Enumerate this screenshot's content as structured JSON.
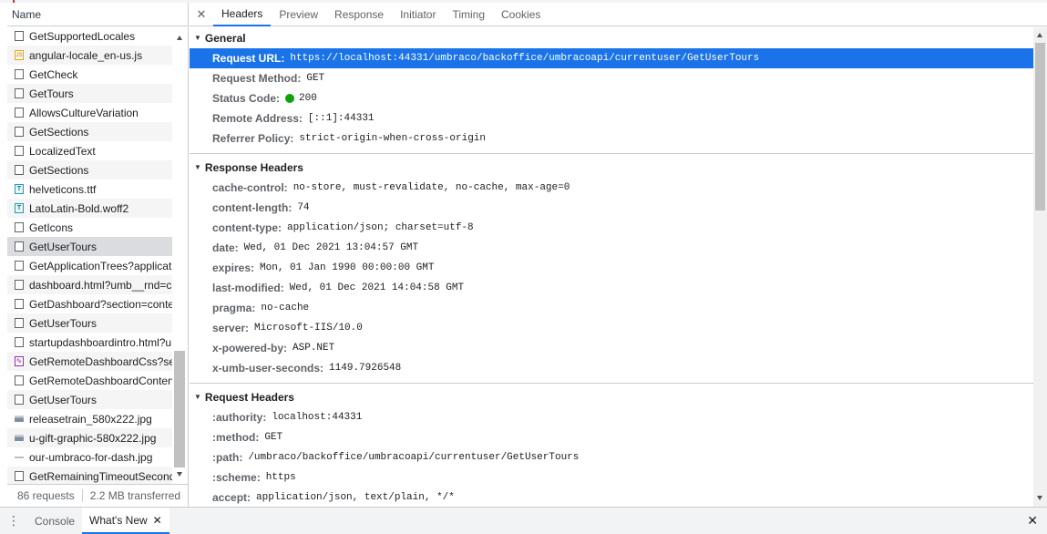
{
  "left_panel": {
    "header": "Name",
    "requests": [
      {
        "name": "GetSupportedLocales",
        "icon": "document-icon"
      },
      {
        "name": "angular-locale_en-us.js",
        "icon": "script-icon"
      },
      {
        "name": "GetCheck",
        "icon": "document-icon"
      },
      {
        "name": "GetTours",
        "icon": "document-icon"
      },
      {
        "name": "AllowsCultureVariation",
        "icon": "document-icon"
      },
      {
        "name": "GetSections",
        "icon": "document-icon"
      },
      {
        "name": "LocalizedText",
        "icon": "document-icon"
      },
      {
        "name": "GetSections",
        "icon": "document-icon"
      },
      {
        "name": "helveticons.ttf",
        "icon": "font-icon"
      },
      {
        "name": "LatoLatin-Bold.woff2",
        "icon": "font-icon"
      },
      {
        "name": "GetIcons",
        "icon": "document-icon"
      },
      {
        "name": "GetUserTours",
        "icon": "document-icon",
        "selected": true
      },
      {
        "name": "GetApplicationTrees?application=...",
        "icon": "document-icon"
      },
      {
        "name": "dashboard.html?umb__rnd=c...",
        "icon": "document-icon"
      },
      {
        "name": "GetDashboard?section=conte...",
        "icon": "document-icon"
      },
      {
        "name": "GetUserTours",
        "icon": "document-icon"
      },
      {
        "name": "startupdashboardintro.html?u...",
        "icon": "document-icon"
      },
      {
        "name": "GetRemoteDashboardCss?sec...",
        "icon": "stylesheet-icon"
      },
      {
        "name": "GetRemoteDashboardContent...",
        "icon": "document-icon"
      },
      {
        "name": "GetUserTours",
        "icon": "document-icon"
      },
      {
        "name": "releasetrain_580x222.jpg",
        "icon": "image-icon"
      },
      {
        "name": "u-gift-graphic-580x222.jpg",
        "icon": "image-icon"
      },
      {
        "name": "our-umbraco-for-dash.jpg",
        "icon": "placeholder-icon"
      },
      {
        "name": "GetRemainingTimeoutSeconds",
        "icon": "document-icon"
      }
    ],
    "status": {
      "requests": "86 requests",
      "transferred": "2.2 MB transferred"
    }
  },
  "detail_tabs": [
    "Headers",
    "Preview",
    "Response",
    "Initiator",
    "Timing",
    "Cookies"
  ],
  "active_tab": "Headers",
  "general": {
    "title": "General",
    "rows": [
      {
        "key": "Request URL:",
        "value": "https://localhost:44331/umbraco/backoffice/umbracoapi/currentuser/GetUserTours"
      },
      {
        "key": "Request Method:",
        "value": "GET"
      },
      {
        "key": "Status Code:",
        "value": "200"
      },
      {
        "key": "Remote Address:",
        "value": "[::1]:44331"
      },
      {
        "key": "Referrer Policy:",
        "value": "strict-origin-when-cross-origin"
      }
    ]
  },
  "response_headers": {
    "title": "Response Headers",
    "rows": [
      {
        "key": "cache-control:",
        "value": "no-store, must-revalidate, no-cache, max-age=0"
      },
      {
        "key": "content-length:",
        "value": "74"
      },
      {
        "key": "content-type:",
        "value": "application/json; charset=utf-8"
      },
      {
        "key": "date:",
        "value": "Wed, 01 Dec 2021 13:04:57 GMT"
      },
      {
        "key": "expires:",
        "value": "Mon, 01 Jan 1990 00:00:00 GMT"
      },
      {
        "key": "last-modified:",
        "value": "Wed, 01 Dec 2021 14:04:58 GMT"
      },
      {
        "key": "pragma:",
        "value": "no-cache"
      },
      {
        "key": "server:",
        "value": "Microsoft-IIS/10.0"
      },
      {
        "key": "x-powered-by:",
        "value": "ASP.NET"
      },
      {
        "key": "x-umb-user-seconds:",
        "value": "1149.7926548"
      }
    ]
  },
  "request_headers": {
    "title": "Request Headers",
    "rows": [
      {
        "key": ":authority:",
        "value": "localhost:44331"
      },
      {
        "key": ":method:",
        "value": "GET"
      },
      {
        "key": ":path:",
        "value": "/umbraco/backoffice/umbracoapi/currentuser/GetUserTours"
      },
      {
        "key": ":scheme:",
        "value": "https"
      },
      {
        "key": "accept:",
        "value": "application/json, text/plain, */*"
      }
    ]
  },
  "drawer": {
    "tabs": [
      "Console",
      "What's New"
    ],
    "active": "What's New"
  },
  "colors": {
    "accent": "#1a73e8",
    "status_ok": "#0ca40c",
    "border": "#cacdd1"
  }
}
